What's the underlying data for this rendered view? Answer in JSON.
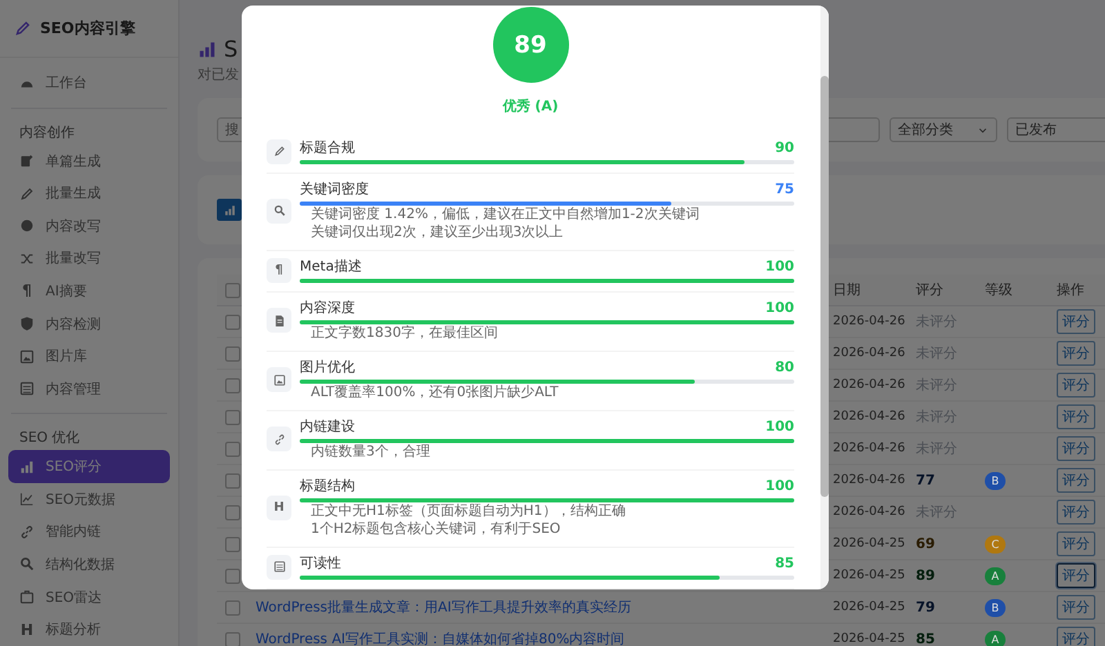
{
  "sidebar": {
    "logo": "SEO内容引擎",
    "sections": [
      {
        "items": [
          {
            "label": "工作台",
            "selected": false
          }
        ]
      },
      {
        "label": "内容创作",
        "items": [
          {
            "label": "单篇生成",
            "selected": false
          },
          {
            "label": "批量生成",
            "selected": false
          },
          {
            "label": "内容改写",
            "selected": false
          },
          {
            "label": "批量改写",
            "selected": false
          },
          {
            "label": "AI摘要",
            "selected": false,
            "icon_text": "¶"
          },
          {
            "label": "内容检测",
            "selected": false
          },
          {
            "label": "图片库",
            "selected": false
          },
          {
            "label": "内容管理",
            "selected": false
          }
        ]
      },
      {
        "label": "SEO 优化",
        "items": [
          {
            "label": "SEO评分",
            "selected": true
          },
          {
            "label": "SEO元数据",
            "selected": false
          },
          {
            "label": "智能内链",
            "selected": false
          },
          {
            "label": "结构化数据",
            "selected": false
          },
          {
            "label": "SEO雷达",
            "selected": false
          },
          {
            "label": "标题分析",
            "selected": false,
            "icon_text": "H"
          }
        ]
      }
    ]
  },
  "page": {
    "title": "S",
    "subtitle": "对已发"
  },
  "filters": {
    "search": {
      "placeholder": "搜"
    },
    "category": {
      "value": "全部分类"
    },
    "status": {
      "value": "已发布"
    }
  },
  "table": {
    "header_checked": false,
    "columns": [
      "日期",
      "评分",
      "等级",
      "操作"
    ],
    "rows": [
      {
        "checked": false,
        "date": "2026-04-26",
        "score": "未评分",
        "action": "评分",
        "focused": false
      },
      {
        "checked": false,
        "date": "2026-04-26",
        "score": "未评分",
        "action": "评分",
        "focused": false
      },
      {
        "checked": false,
        "date": "2026-04-26",
        "score": "未评分",
        "action": "评分",
        "focused": false
      },
      {
        "checked": false,
        "date": "2026-04-26",
        "score": "未评分",
        "action": "评分",
        "focused": false
      },
      {
        "checked": false,
        "date": "2026-04-26",
        "score": "未评分",
        "action": "评分",
        "focused": false
      },
      {
        "checked": false,
        "date": "2026-04-26",
        "score": "77",
        "grade": "B",
        "color": "#1f4fa8",
        "action": "评分",
        "focused": false
      },
      {
        "checked": false,
        "date": "2026-04-26",
        "score": "未评分",
        "action": "评分",
        "focused": false
      },
      {
        "checked": false,
        "date": "2026-04-25",
        "score": "69",
        "grade": "C",
        "color": "#b07810",
        "action": "评分",
        "focused": false
      },
      {
        "checked": false,
        "date": "2026-04-25",
        "score": "89",
        "grade": "A",
        "color": "#18803c",
        "action": "评分",
        "focused": true
      },
      {
        "checked": false,
        "title": "WordPress批量生成文章：用AI写作工具提升效率的真实经历",
        "date": "2026-04-25",
        "score": "79",
        "grade": "B",
        "color": "#1f4fa8",
        "action": "评分",
        "focused": false
      },
      {
        "checked": false,
        "title": "WordPress AI写作工具实测：自媒体如何省掉80%内容时间",
        "date": "2026-04-25",
        "score": "85",
        "grade": "A",
        "color": "#18803c",
        "action": "评分",
        "focused": false
      }
    ]
  },
  "modal": {
    "score": "89",
    "rating": "优秀 (A)",
    "items": [
      {
        "name": "标题合规",
        "score": "90",
        "level": 0.9,
        "color": "#22c55e"
      },
      {
        "name": "关键词密度",
        "score": "75",
        "level": 0.75,
        "color": "#3b82f6",
        "notes": [
          "关键词密度 1.42%，偏低，建议在正文中自然增加1-2次关键词",
          "关键词仅出现2次，建议至少出现3次以上"
        ]
      },
      {
        "name": "Meta描述",
        "score": "100",
        "level": 1,
        "color": "#22c55e",
        "icon_text": "¶"
      },
      {
        "name": "内容深度",
        "score": "100",
        "level": 1,
        "color": "#22c55e",
        "notes": [
          "正文字数1830字，在最佳区间"
        ]
      },
      {
        "name": "图片优化",
        "score": "80",
        "level": 0.8,
        "color": "#22c55e",
        "notes": [
          "ALT覆盖率100%，还有0张图片缺少ALT"
        ]
      },
      {
        "name": "内链建设",
        "score": "100",
        "level": 1,
        "color": "#22c55e",
        "notes": [
          "内链数量3个，合理"
        ]
      },
      {
        "name": "标题结构",
        "score": "100",
        "level": 1,
        "color": "#22c55e",
        "icon_text": "H",
        "notes": [
          "正文中无H1标签（页面标题自动为H1），结构正确",
          "1个H2标题包含核心关键词，有利于SEO"
        ]
      },
      {
        "name": "可读性",
        "score": "85",
        "level": 0.85,
        "color": "#22c55e"
      }
    ]
  }
}
